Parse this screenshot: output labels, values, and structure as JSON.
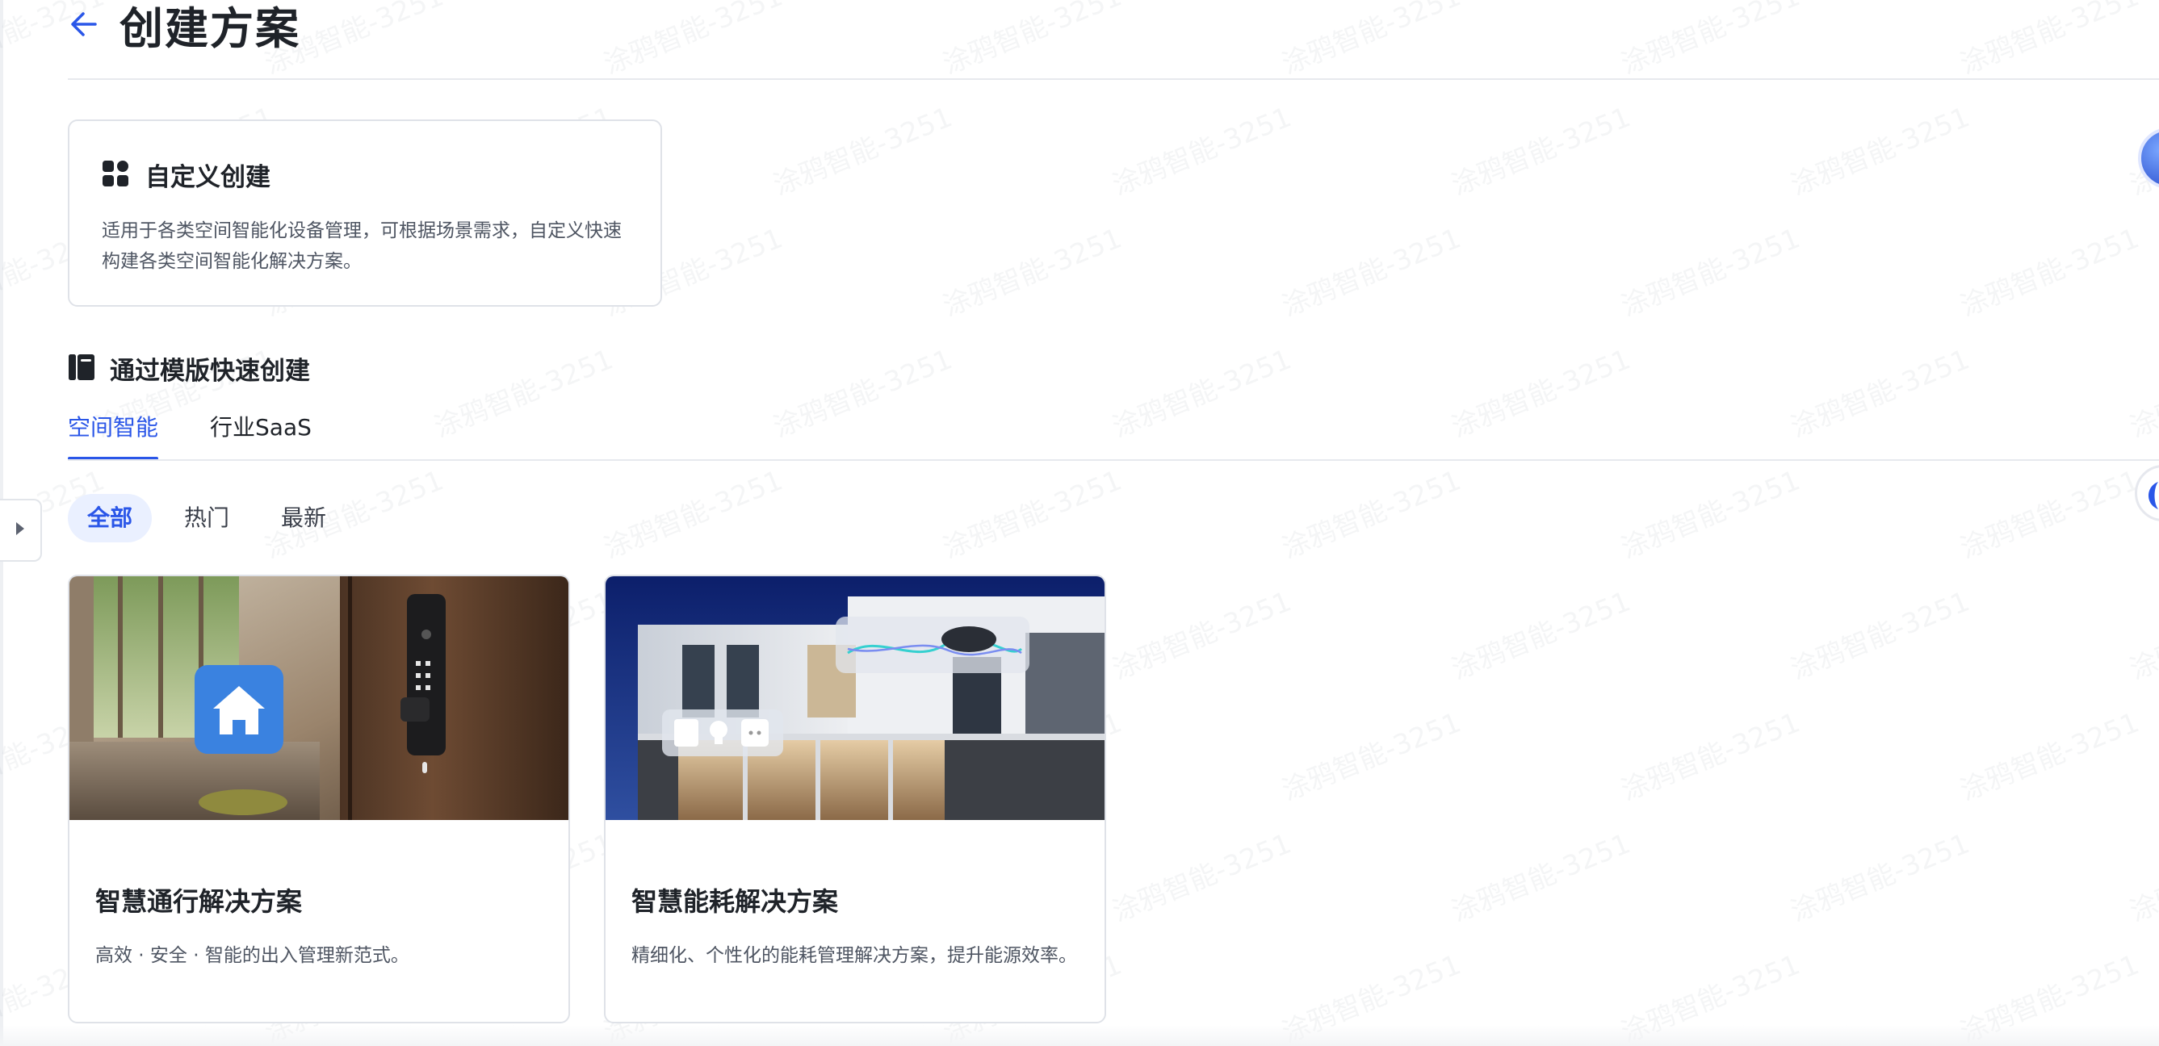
{
  "header": {
    "back_icon": "arrow-left-icon",
    "title": "创建方案"
  },
  "custom_create": {
    "icon": "grid-apps-icon",
    "title": "自定义创建",
    "description": "适用于各类空间智能化设备管理，可根据场景需求，自定义快速构建各类空间智能化解决方案。"
  },
  "template_section": {
    "icon": "template-book-icon",
    "title": "通过模版快速创建",
    "tabs": [
      {
        "label": "空间智能",
        "active": true
      },
      {
        "label": "行业SaaS",
        "active": false
      }
    ],
    "filters": [
      {
        "label": "全部",
        "active": true
      },
      {
        "label": "热门",
        "active": false
      },
      {
        "label": "最新",
        "active": false
      }
    ],
    "cards": [
      {
        "image": "smart-door-lock-image",
        "title": "智慧通行解决方案",
        "description": "高效 · 安全 · 智能的出入管理新范式。"
      },
      {
        "image": "smart-building-energy-image",
        "title": "智慧能耗解决方案",
        "description": "精细化、个性化的能耗管理解决方案，提升能源效率。"
      }
    ]
  },
  "watermark": {
    "text": "涂鸦智能-3251"
  },
  "colors": {
    "accent": "#2a56e8",
    "accent_bg": "#eaf0ff",
    "text_primary": "#1f2329",
    "text_secondary": "#4e5562",
    "border": "#dfe2e8"
  }
}
